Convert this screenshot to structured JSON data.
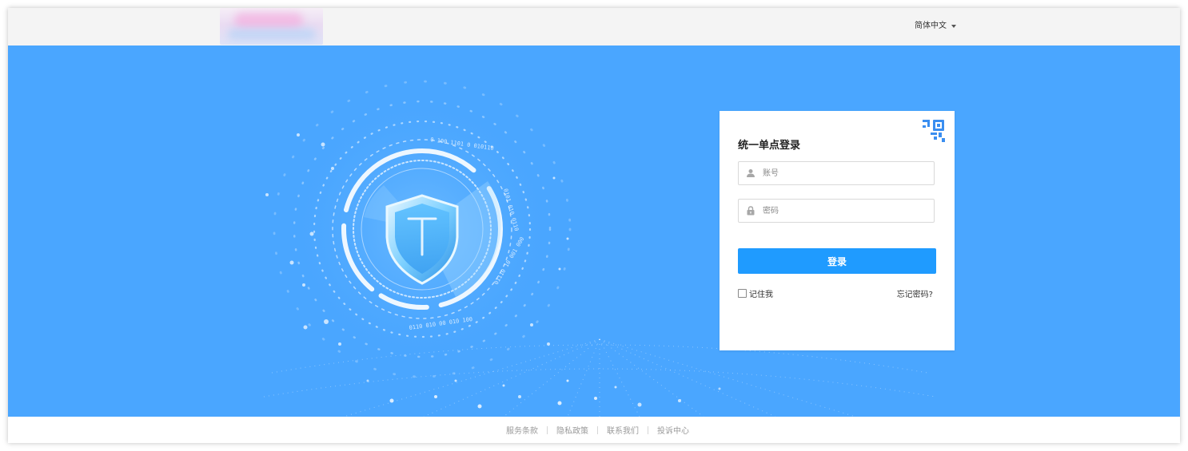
{
  "header": {
    "logo_label": "logo",
    "language": "简体中文"
  },
  "login": {
    "title": "统一单点登录",
    "qr_icon": "qr-code-icon",
    "account_placeholder": "账号",
    "password_placeholder": "密码",
    "account_icon": "user-icon",
    "password_icon": "lock-icon",
    "submit_label": "登录",
    "remember_label": "记住我",
    "forgot_label": "忘记密码?"
  },
  "footer": {
    "links": [
      "服务条款",
      "隐私政策",
      "联系我们",
      "投诉中心"
    ]
  },
  "colors": {
    "hero_bg": "#4aa6ff",
    "primary_button": "#1f9bff",
    "topbar_bg": "#f4f4f4"
  }
}
